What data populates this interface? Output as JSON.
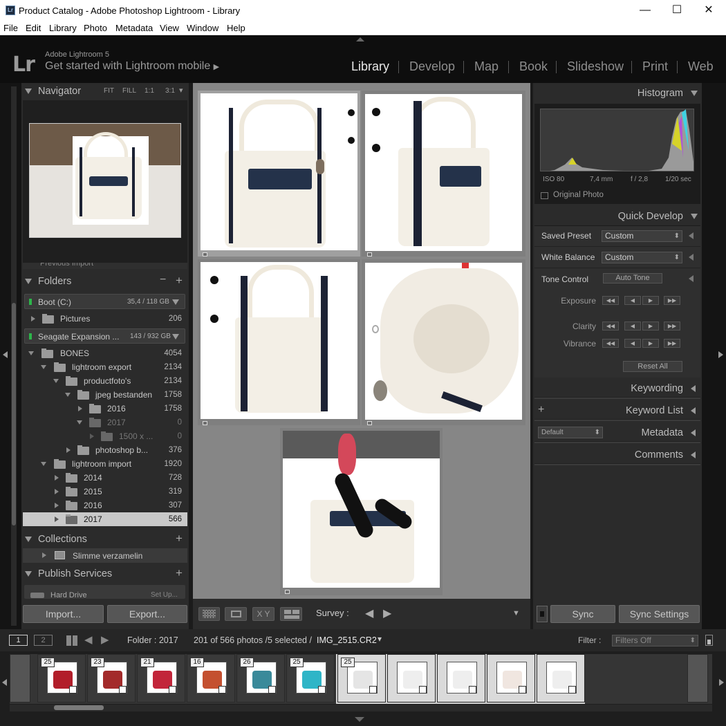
{
  "window": {
    "title": "Product Catalog - Adobe Photoshop Lightroom - Library",
    "app_icon": "Lr",
    "minimize": "—",
    "maximize": "☐",
    "close": "✕"
  },
  "menu": [
    "File",
    "Edit",
    "Library",
    "Photo",
    "Metadata",
    "View",
    "Window",
    "Help"
  ],
  "identity": {
    "logo": "Lr",
    "product": "Adobe Lightroom 5",
    "tagline": "Get started with Lightroom mobile",
    "arrow": "▶"
  },
  "modules": [
    "Library",
    "Develop",
    "Map",
    "Book",
    "Slideshow",
    "Print",
    "Web"
  ],
  "left": {
    "navigator": {
      "title": "Navigator",
      "zooms": [
        "FIT",
        "FILL",
        "1:1",
        "3:1"
      ],
      "zoom_arrow": "▾"
    },
    "folders": {
      "title": "Folders",
      "minus": "−",
      "plus": "+",
      "volumes": [
        {
          "name": "Boot (C:)",
          "size": "35,4 / 118 GB"
        },
        {
          "name": "Seagate Expansion ...",
          "size": "143 / 932 GB"
        }
      ],
      "rows": [
        {
          "name": "Pictures",
          "count": "206"
        },
        {
          "name": "BONES",
          "count": "4054"
        },
        {
          "name": "lightroom export",
          "count": "2134"
        },
        {
          "name": "productfoto's",
          "count": "2134"
        },
        {
          "name": "jpeg bestanden",
          "count": "1758"
        },
        {
          "name": "2016",
          "count": "1758"
        },
        {
          "name": "2017",
          "count": "0"
        },
        {
          "name": "1500 x ...",
          "count": "0"
        },
        {
          "name": "photoshop b...",
          "count": "376"
        },
        {
          "name": "lightroom import",
          "count": "1920"
        },
        {
          "name": "2014",
          "count": "728"
        },
        {
          "name": "2015",
          "count": "319"
        },
        {
          "name": "2016",
          "count": "307"
        },
        {
          "name": "2017",
          "count": "566"
        }
      ],
      "hidden_row": "Previous Import"
    },
    "collections": {
      "title": "Collections",
      "plus": "+",
      "item": "Slimme verzamelin"
    },
    "publish": {
      "title": "Publish Services",
      "plus": "+",
      "item": "Hard Drive",
      "setup": "Set Up..."
    },
    "import_label": "Import...",
    "export_label": "Export..."
  },
  "right": {
    "histogram": {
      "title": "Histogram",
      "iso": "ISO 80",
      "focal": "7,4 mm",
      "aperture": "f / 2,8",
      "shutter": "1/20 sec",
      "original": "Original Photo"
    },
    "quick_develop": {
      "title": "Quick Develop",
      "saved_preset_label": "Saved Preset",
      "saved_preset_value": "Custom",
      "white_balance_label": "White Balance",
      "white_balance_value": "Custom",
      "tone_control_label": "Tone Control",
      "auto_tone": "Auto Tone",
      "exposure": "Exposure",
      "clarity": "Clarity",
      "vibrance": "Vibrance",
      "reset_all": "Reset All",
      "step_labels": [
        "◀◀",
        "◀",
        "▶",
        "▶▶"
      ],
      "spin": "⬍"
    },
    "keywording": "Keywording",
    "keyword_list": "Keyword List",
    "keyword_plus": "+",
    "metadata": "Metadata",
    "metadata_preset": "Default",
    "comments": "Comments",
    "sync_label": "Sync",
    "sync_settings_label": "Sync Settings"
  },
  "toolbar": {
    "sort_label": "Survey :",
    "prev": "◀",
    "next": "▶",
    "compare_label": "X Y",
    "chevron": "▼"
  },
  "filmstrip_bar": {
    "page1": "1",
    "page2": "2",
    "folder": "Folder : 2017",
    "count": "201 of 566 photos /5 selected /",
    "filename": "IMG_2515.CR2",
    "dropdown": "▾",
    "filter_label": "Filter :",
    "filter_value": "Filters Off"
  },
  "filmstrip": {
    "badges": [
      "25",
      "23",
      "21",
      "16",
      "26",
      "25",
      "25",
      "",
      "",
      "",
      ""
    ],
    "colors": [
      "#b21e2a",
      "#a32a2a",
      "#c2253a",
      "#c45030",
      "#3a8a9a",
      "#2fb5c7",
      "#e5e5e5",
      "#eeeeee",
      "#eeeeee",
      "#f0e6e0",
      "#eeeeee"
    ]
  },
  "colors": {
    "accent_text": "#e8e8e8",
    "panel_bg": "#2b2b2b",
    "grid_bg": "#868686"
  }
}
